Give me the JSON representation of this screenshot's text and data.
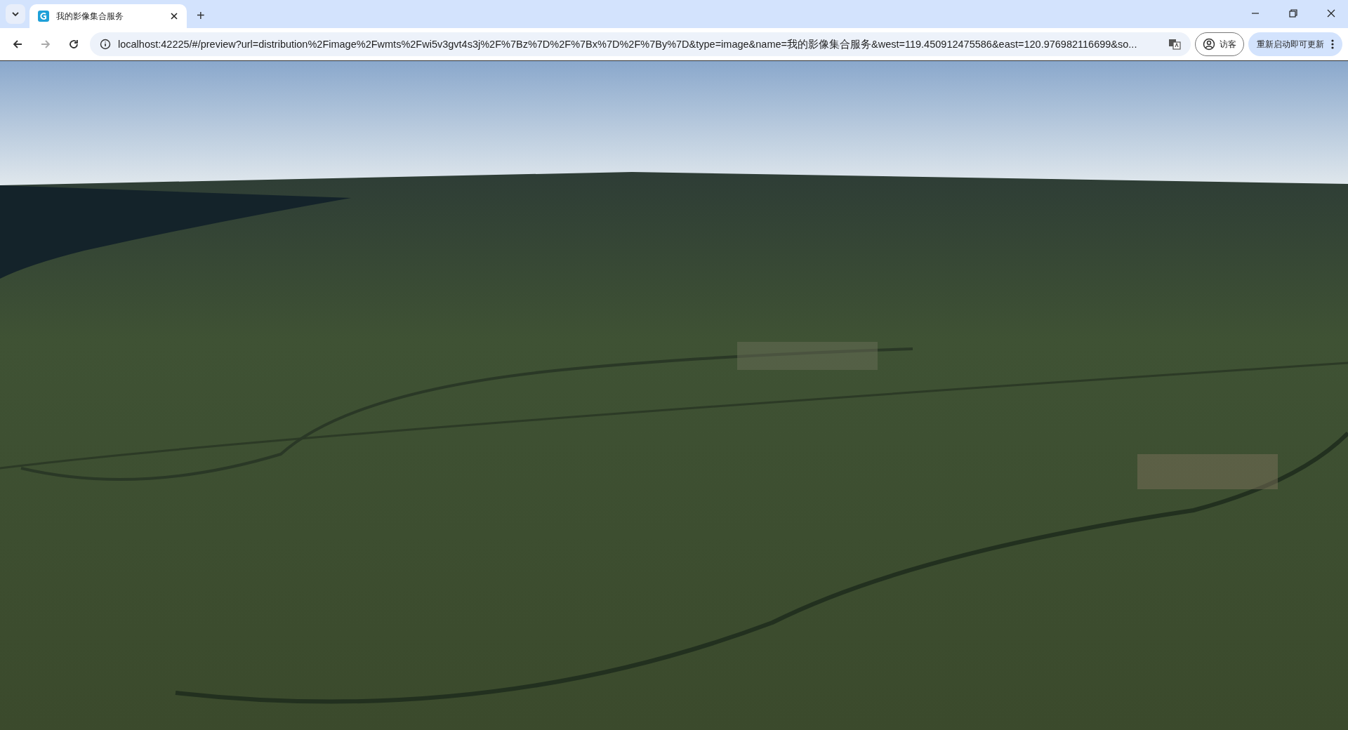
{
  "tabs": [
    {
      "title": "我的影像集合服务",
      "selected": true
    }
  ],
  "address_bar": {
    "url": "localhost:42225/#/preview?url=distribution%2Fimage%2Fwmts%2Fwi5v3gvt4s3j%2F%7Bz%7D%2F%7Bx%7D%2F%7By%7D&type=image&name=我的影像集合服务&west=119.450912475586&east=120.976982116699&so..."
  },
  "profile": {
    "label": "访客"
  },
  "update_button": {
    "label": "重新启动即可更新"
  },
  "new_tab": {
    "label": "+"
  }
}
